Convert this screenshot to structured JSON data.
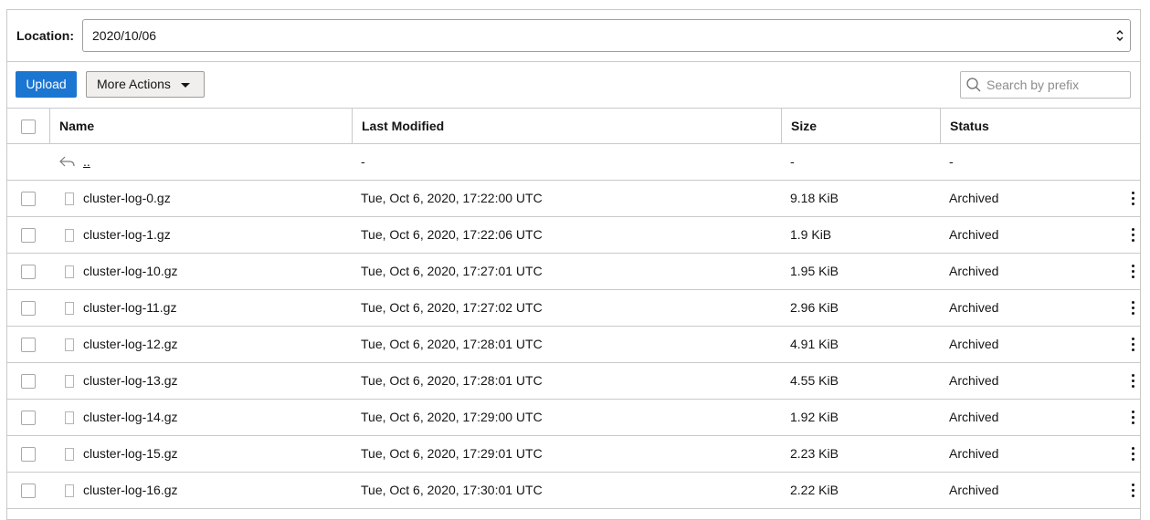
{
  "location": {
    "label": "Location:",
    "value": "2020/10/06"
  },
  "toolbar": {
    "upload_label": "Upload",
    "more_actions_label": "More Actions",
    "search_placeholder": "Search by prefix",
    "upload_color": "#1b76d2"
  },
  "table": {
    "headers": {
      "name": "Name",
      "last_modified": "Last Modified",
      "size": "Size",
      "status": "Status"
    },
    "parent_row": {
      "name": "..",
      "last_modified": "-",
      "size": "-",
      "status": "-"
    },
    "rows": [
      {
        "name": "cluster-log-0.gz",
        "last_modified": "Tue, Oct 6, 2020, 17:22:00 UTC",
        "size": "9.18 KiB",
        "status": "Archived"
      },
      {
        "name": "cluster-log-1.gz",
        "last_modified": "Tue, Oct 6, 2020, 17:22:06 UTC",
        "size": "1.9 KiB",
        "status": "Archived"
      },
      {
        "name": "cluster-log-10.gz",
        "last_modified": "Tue, Oct 6, 2020, 17:27:01 UTC",
        "size": "1.95 KiB",
        "status": "Archived"
      },
      {
        "name": "cluster-log-11.gz",
        "last_modified": "Tue, Oct 6, 2020, 17:27:02 UTC",
        "size": "2.96 KiB",
        "status": "Archived"
      },
      {
        "name": "cluster-log-12.gz",
        "last_modified": "Tue, Oct 6, 2020, 17:28:01 UTC",
        "size": "4.91 KiB",
        "status": "Archived"
      },
      {
        "name": "cluster-log-13.gz",
        "last_modified": "Tue, Oct 6, 2020, 17:28:01 UTC",
        "size": "4.55 KiB",
        "status": "Archived"
      },
      {
        "name": "cluster-log-14.gz",
        "last_modified": "Tue, Oct 6, 2020, 17:29:00 UTC",
        "size": "1.92 KiB",
        "status": "Archived"
      },
      {
        "name": "cluster-log-15.gz",
        "last_modified": "Tue, Oct 6, 2020, 17:29:01 UTC",
        "size": "2.23 KiB",
        "status": "Archived"
      },
      {
        "name": "cluster-log-16.gz",
        "last_modified": "Tue, Oct 6, 2020, 17:30:01 UTC",
        "size": "2.22 KiB",
        "status": "Archived"
      }
    ]
  }
}
